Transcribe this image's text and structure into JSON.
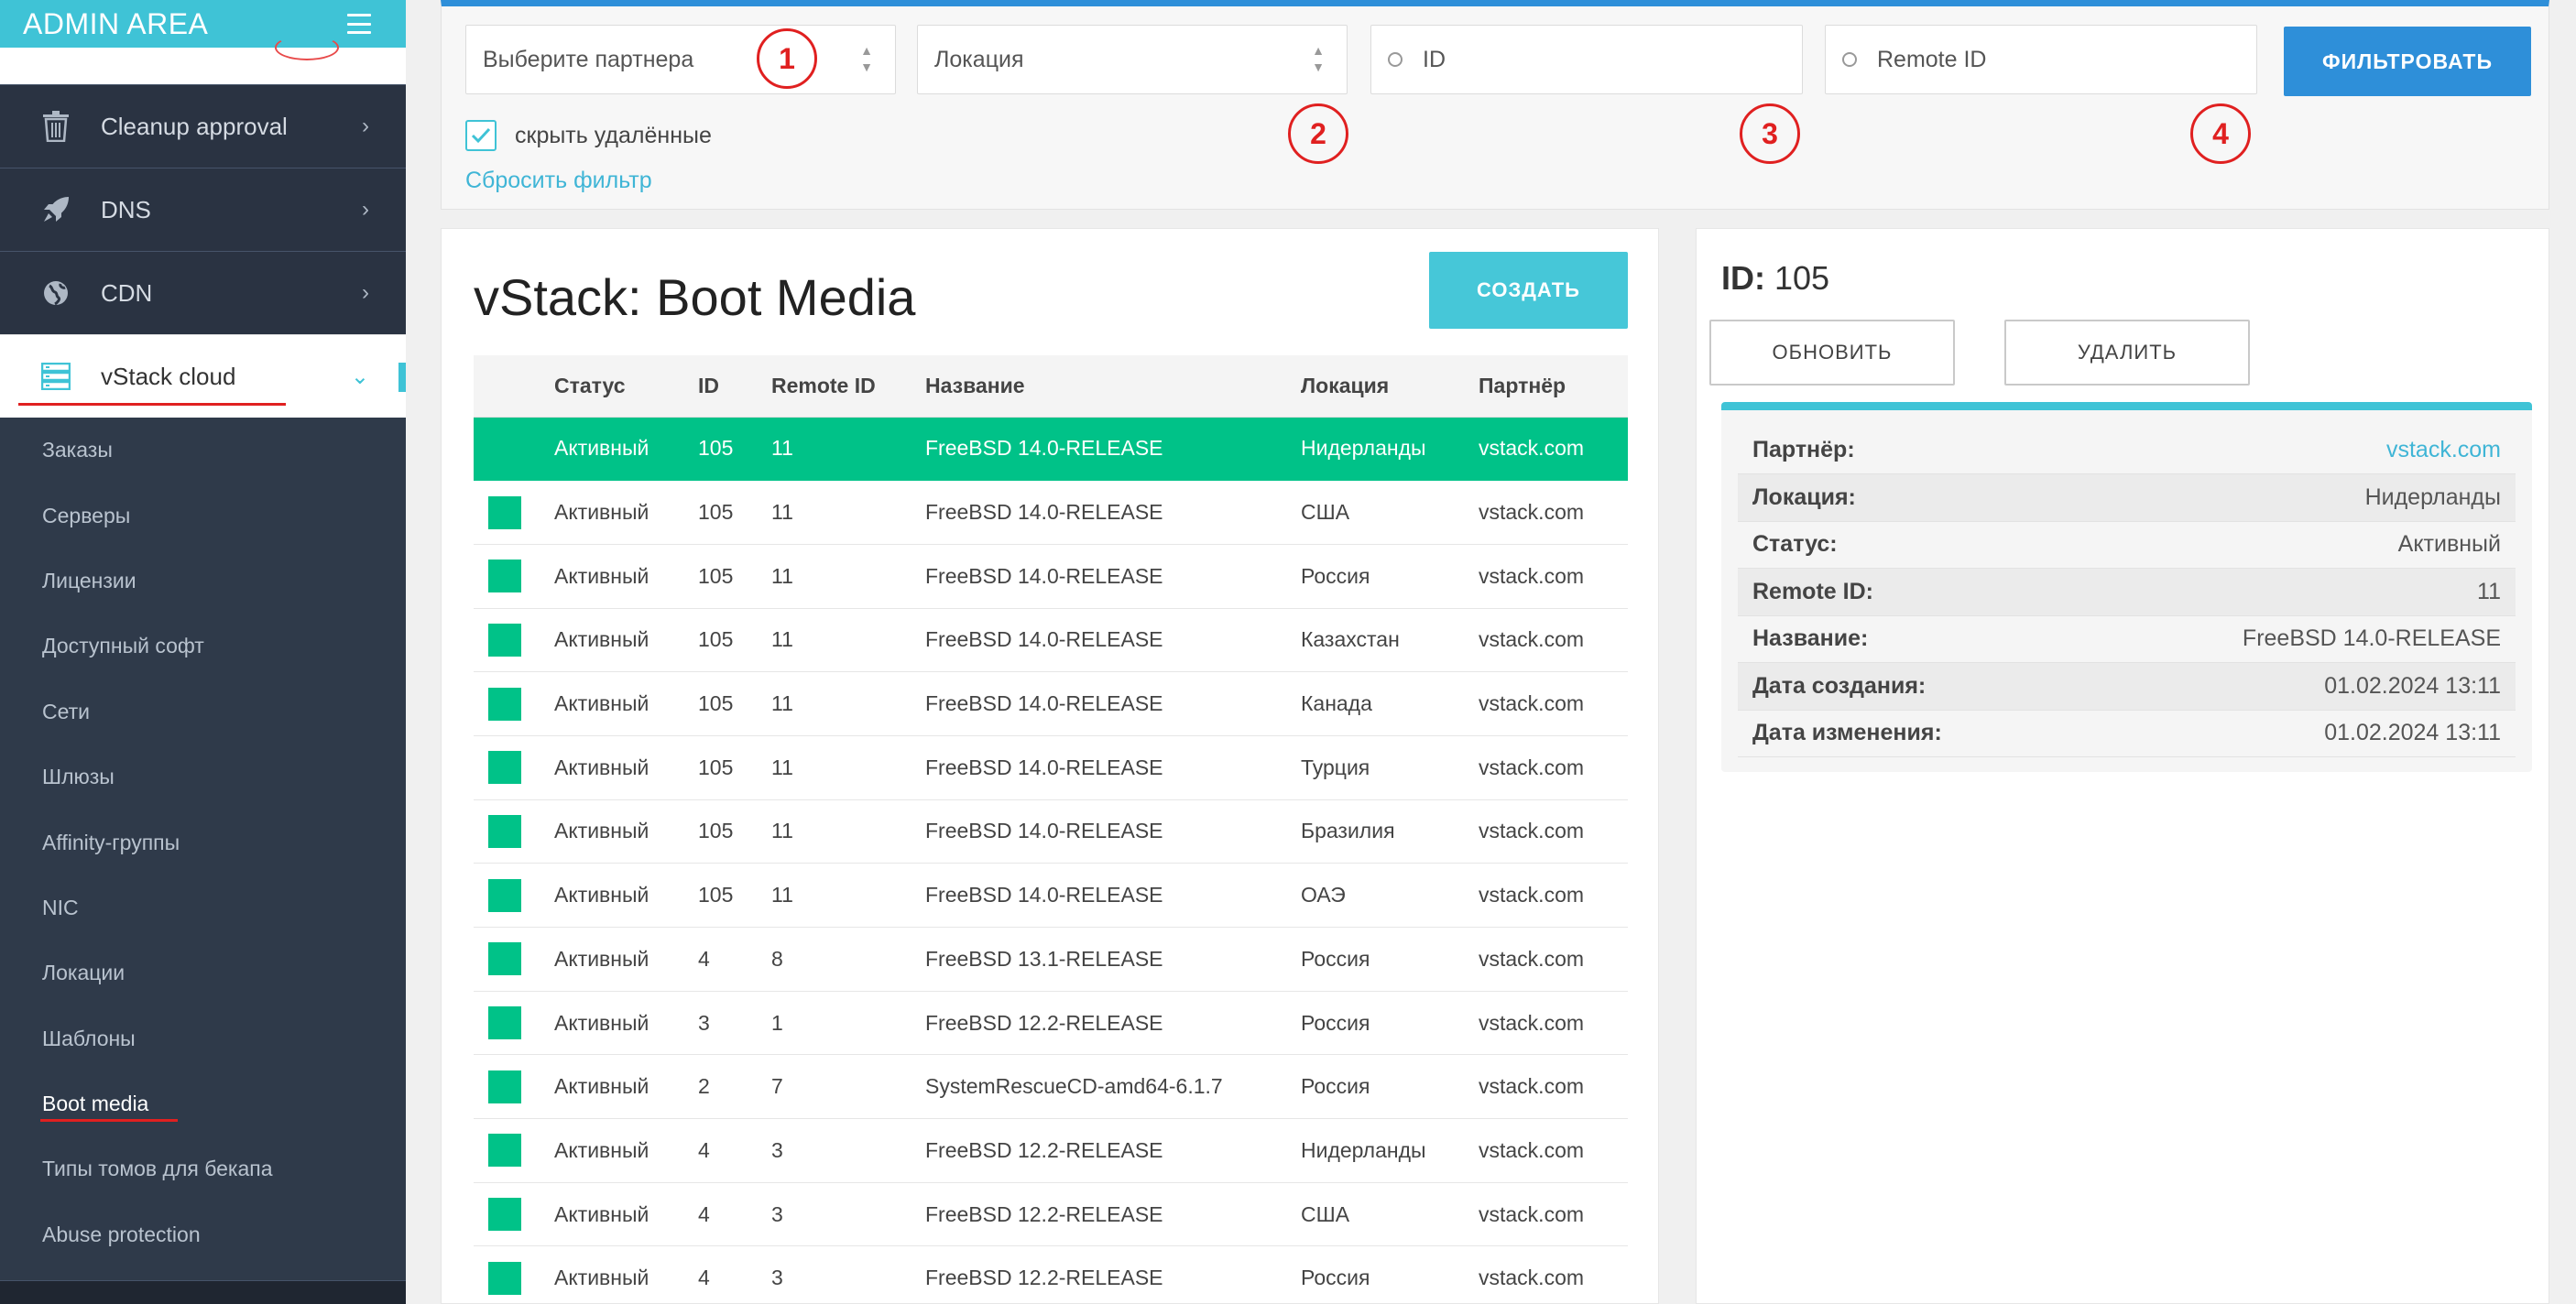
{
  "sidebar": {
    "brand": "ADMIN AREA",
    "main_items": [
      {
        "label": "Cleanup approval",
        "icon": "trash-icon"
      },
      {
        "label": "DNS",
        "icon": "rocket-icon"
      },
      {
        "label": "CDN",
        "icon": "globe-icon"
      },
      {
        "label": "vStack cloud",
        "icon": "server-icon",
        "active": true
      }
    ],
    "sub_items": [
      "Заказы",
      "Серверы",
      "Лицензии",
      "Доступный софт",
      "Сети",
      "Шлюзы",
      "Affinity-группы",
      "NIC",
      "Локации",
      "Шаблоны",
      "Boot media",
      "Типы томов для бекапа",
      "Abuse protection"
    ],
    "active_sub": "Boot media"
  },
  "filter": {
    "partner_placeholder": "Выберите партнера",
    "location_placeholder": "Локация",
    "id_placeholder": "ID",
    "remote_id_placeholder": "Remote ID",
    "filter_button": "ФИЛЬТРОВАТЬ",
    "hide_deleted_label": "скрыть удалённые",
    "hide_deleted_checked": true,
    "reset_link": "Сбросить фильтр",
    "markers": [
      "1",
      "2",
      "3",
      "4"
    ]
  },
  "list": {
    "title": "vStack: Boot Media",
    "create_button": "СОЗДАТЬ",
    "columns": [
      "",
      "Статус",
      "ID",
      "Remote ID",
      "Название",
      "Локация",
      "Партнёр"
    ],
    "rows": [
      {
        "status": "Активный",
        "id": "105",
        "remote_id": "11",
        "name": "FreeBSD 14.0-RELEASE",
        "location": "Нидерланды",
        "partner": "vstack.com",
        "selected": true
      },
      {
        "status": "Активный",
        "id": "105",
        "remote_id": "11",
        "name": "FreeBSD 14.0-RELEASE",
        "location": "США",
        "partner": "vstack.com"
      },
      {
        "status": "Активный",
        "id": "105",
        "remote_id": "11",
        "name": "FreeBSD 14.0-RELEASE",
        "location": "Россия",
        "partner": "vstack.com"
      },
      {
        "status": "Активный",
        "id": "105",
        "remote_id": "11",
        "name": "FreeBSD 14.0-RELEASE",
        "location": "Казахстан",
        "partner": "vstack.com"
      },
      {
        "status": "Активный",
        "id": "105",
        "remote_id": "11",
        "name": "FreeBSD 14.0-RELEASE",
        "location": "Канада",
        "partner": "vstack.com"
      },
      {
        "status": "Активный",
        "id": "105",
        "remote_id": "11",
        "name": "FreeBSD 14.0-RELEASE",
        "location": "Турция",
        "partner": "vstack.com"
      },
      {
        "status": "Активный",
        "id": "105",
        "remote_id": "11",
        "name": "FreeBSD 14.0-RELEASE",
        "location": "Бразилия",
        "partner": "vstack.com"
      },
      {
        "status": "Активный",
        "id": "105",
        "remote_id": "11",
        "name": "FreeBSD 14.0-RELEASE",
        "location": "ОАЭ",
        "partner": "vstack.com"
      },
      {
        "status": "Активный",
        "id": "4",
        "remote_id": "8",
        "name": "FreeBSD 13.1-RELEASE",
        "location": "Россия",
        "partner": "vstack.com"
      },
      {
        "status": "Активный",
        "id": "3",
        "remote_id": "1",
        "name": "FreeBSD 12.2-RELEASE",
        "location": "Россия",
        "partner": "vstack.com"
      },
      {
        "status": "Активный",
        "id": "2",
        "remote_id": "7",
        "name": "SystemRescueCD-amd64-6.1.7",
        "location": "Россия",
        "partner": "vstack.com"
      },
      {
        "status": "Активный",
        "id": "4",
        "remote_id": "3",
        "name": "FreeBSD 12.2-RELEASE",
        "location": "Нидерланды",
        "partner": "vstack.com"
      },
      {
        "status": "Активный",
        "id": "4",
        "remote_id": "3",
        "name": "FreeBSD 12.2-RELEASE",
        "location": "США",
        "partner": "vstack.com"
      },
      {
        "status": "Активный",
        "id": "4",
        "remote_id": "3",
        "name": "FreeBSD 12.2-RELEASE",
        "location": "Россия",
        "partner": "vstack.com"
      }
    ]
  },
  "detail": {
    "id_label": "ID:",
    "id_value": "105",
    "update_button": "ОБНОВИТЬ",
    "delete_button": "УДАЛИТЬ",
    "fields": [
      {
        "key": "Партнёр:",
        "value": "vstack.com",
        "link": true
      },
      {
        "key": "Локация:",
        "value": "Нидерланды"
      },
      {
        "key": "Статус:",
        "value": "Активный"
      },
      {
        "key": "Remote ID:",
        "value": "11"
      },
      {
        "key": "Название:",
        "value": "FreeBSD 14.0-RELEASE"
      },
      {
        "key": "Дата создания:",
        "value": "01.02.2024 13:11"
      },
      {
        "key": "Дата изменения:",
        "value": "01.02.2024 13:11"
      }
    ]
  },
  "colors": {
    "brand": "#3fc3d6",
    "primary": "#2e8fd9",
    "status_active": "#00c288",
    "annotation": "#e02020",
    "sidebar_bg": "#2f3a4a"
  }
}
